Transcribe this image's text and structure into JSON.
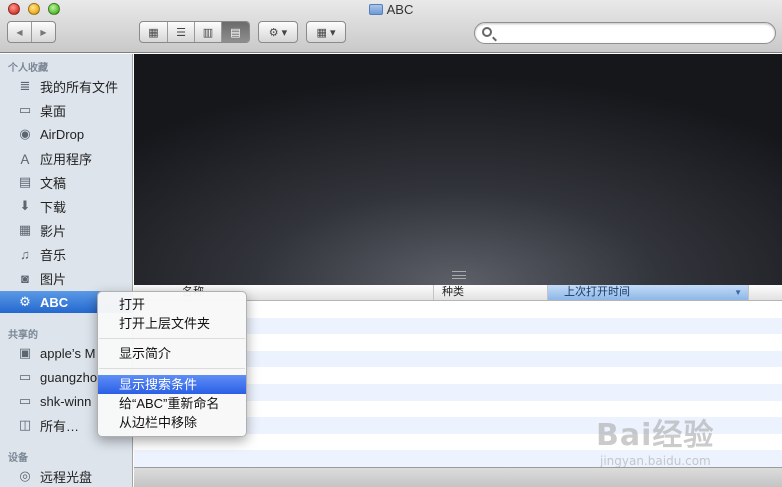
{
  "window": {
    "title": "ABC"
  },
  "toolbar": {
    "back_symbol": "◀",
    "forward_symbol": "▶",
    "view_icons": "▦",
    "view_list": "☰",
    "view_columns": "▥",
    "view_coverflow": "▤",
    "action_symbol": "⚙ ▾",
    "arrange_symbol": "▦ ▾",
    "search_placeholder": ""
  },
  "sidebar": {
    "favorites_title": "个人收藏",
    "favorites": [
      {
        "label": "我的所有文件",
        "icon": "≣"
      },
      {
        "label": "桌面",
        "icon": "▭"
      },
      {
        "label": "AirDrop",
        "icon": "◉"
      },
      {
        "label": "应用程序",
        "icon": "Ａ"
      },
      {
        "label": "文稿",
        "icon": "▤"
      },
      {
        "label": "下载",
        "icon": "⬇"
      },
      {
        "label": "影片",
        "icon": "▦"
      },
      {
        "label": "音乐",
        "icon": "♫"
      },
      {
        "label": "图片",
        "icon": "◙"
      },
      {
        "label": "ABC",
        "icon": "⚙"
      }
    ],
    "shared_title": "共享的",
    "shared": [
      {
        "label": "apple’s M",
        "icon": "▣"
      },
      {
        "label": "guangzho",
        "icon": "▭"
      },
      {
        "label": "shk-winn",
        "icon": "▭"
      },
      {
        "label": "所有…",
        "icon": "◫"
      }
    ],
    "devices_title": "设备",
    "devices": [
      {
        "label": "远程光盘",
        "icon": "◎"
      }
    ]
  },
  "list": {
    "columns": {
      "name": "名称",
      "kind": "种类",
      "last_opened": "上次打开时间",
      "sort_symbol": "▼"
    }
  },
  "context_menu": {
    "items": [
      {
        "label": "打开"
      },
      {
        "label": "打开上层文件夹"
      },
      {
        "label": "显示简介"
      },
      {
        "label": "显示搜索条件"
      },
      {
        "label": "给“ABC”重新命名"
      },
      {
        "label": "从边栏中移除"
      }
    ],
    "highlighted_index": 3
  },
  "watermark": {
    "brand": "Bai经验",
    "url": "jingyan.baidu.com"
  },
  "colors": {
    "selection_blue": "#2368cf",
    "menu_highlight": "#2a5fe6",
    "sidebar_bg": "#dde4ec"
  }
}
